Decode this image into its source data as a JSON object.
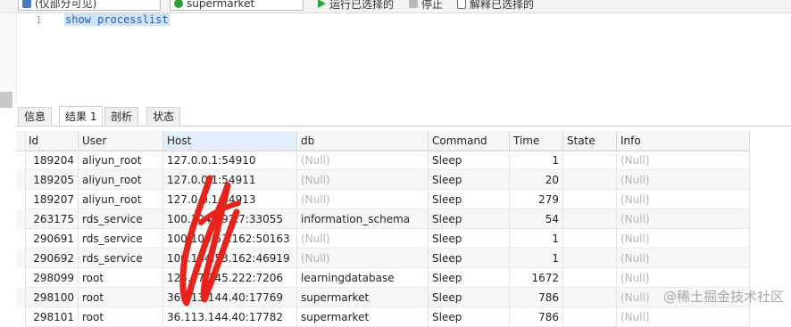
{
  "toolbar": {
    "connection": "(仅部分可见)",
    "database": "supermarket",
    "run_selected": "运行已选择的",
    "stop": "停止",
    "explain_selected": "解释已选择的"
  },
  "editor": {
    "line_number": "1",
    "sql": "show processlist"
  },
  "tabs": [
    {
      "label": "信息"
    },
    {
      "label": "结果 1"
    },
    {
      "label": "剖析"
    },
    {
      "label": "状态"
    }
  ],
  "grid": {
    "columns": [
      "Id",
      "User",
      "Host",
      "db",
      "Command",
      "Time",
      "State",
      "Info"
    ],
    "rows": [
      {
        "id": "189204",
        "user": "aliyun_root",
        "host": "127.0.0.1:54910",
        "db": "(Null)",
        "command": "Sleep",
        "time": "1",
        "state": "",
        "info": "(Null)"
      },
      {
        "id": "189205",
        "user": "aliyun_root",
        "host": "127.0.0.1:54911",
        "db": "(Null)",
        "command": "Sleep",
        "time": "20",
        "state": "",
        "info": "(Null)"
      },
      {
        "id": "189207",
        "user": "aliyun_root",
        "host": "127.0.0.1:54913",
        "db": "(Null)",
        "command": "Sleep",
        "time": "279",
        "state": "",
        "info": "(Null)"
      },
      {
        "id": "263175",
        "user": "rds_service",
        "host": "100.104.192.7:33055",
        "db": "information_schema",
        "command": "Sleep",
        "time": "54",
        "state": "",
        "info": "(Null)"
      },
      {
        "id": "290691",
        "user": "rds_service",
        "host": "100.104.53.162:50163",
        "db": "(Null)",
        "command": "Sleep",
        "time": "1",
        "state": "",
        "info": "(Null)"
      },
      {
        "id": "290692",
        "user": "rds_service",
        "host": "100.104.53.162:46919",
        "db": "(Null)",
        "command": "Sleep",
        "time": "1",
        "state": "",
        "info": "(Null)"
      },
      {
        "id": "298099",
        "user": "root",
        "host": "123.57.245.222:7206",
        "db": "learningdatabase",
        "command": "Sleep",
        "time": "1672",
        "state": "",
        "info": "(Null)"
      },
      {
        "id": "298100",
        "user": "root",
        "host": "36.113.144.40:17769",
        "db": "supermarket",
        "command": "Sleep",
        "time": "786",
        "state": "",
        "info": "(Null)"
      },
      {
        "id": "298101",
        "user": "root",
        "host": "36.113.144.40:17782",
        "db": "supermarket",
        "command": "Sleep",
        "time": "786",
        "state": "",
        "info": "(Null)"
      }
    ]
  },
  "watermark": "@稀土掘金技术社区",
  "colors": {
    "selection": "#cfe3f7",
    "sql_text": "#1f5fbf",
    "null_text": "#b5b5b5",
    "scribble": "#e8231c"
  }
}
